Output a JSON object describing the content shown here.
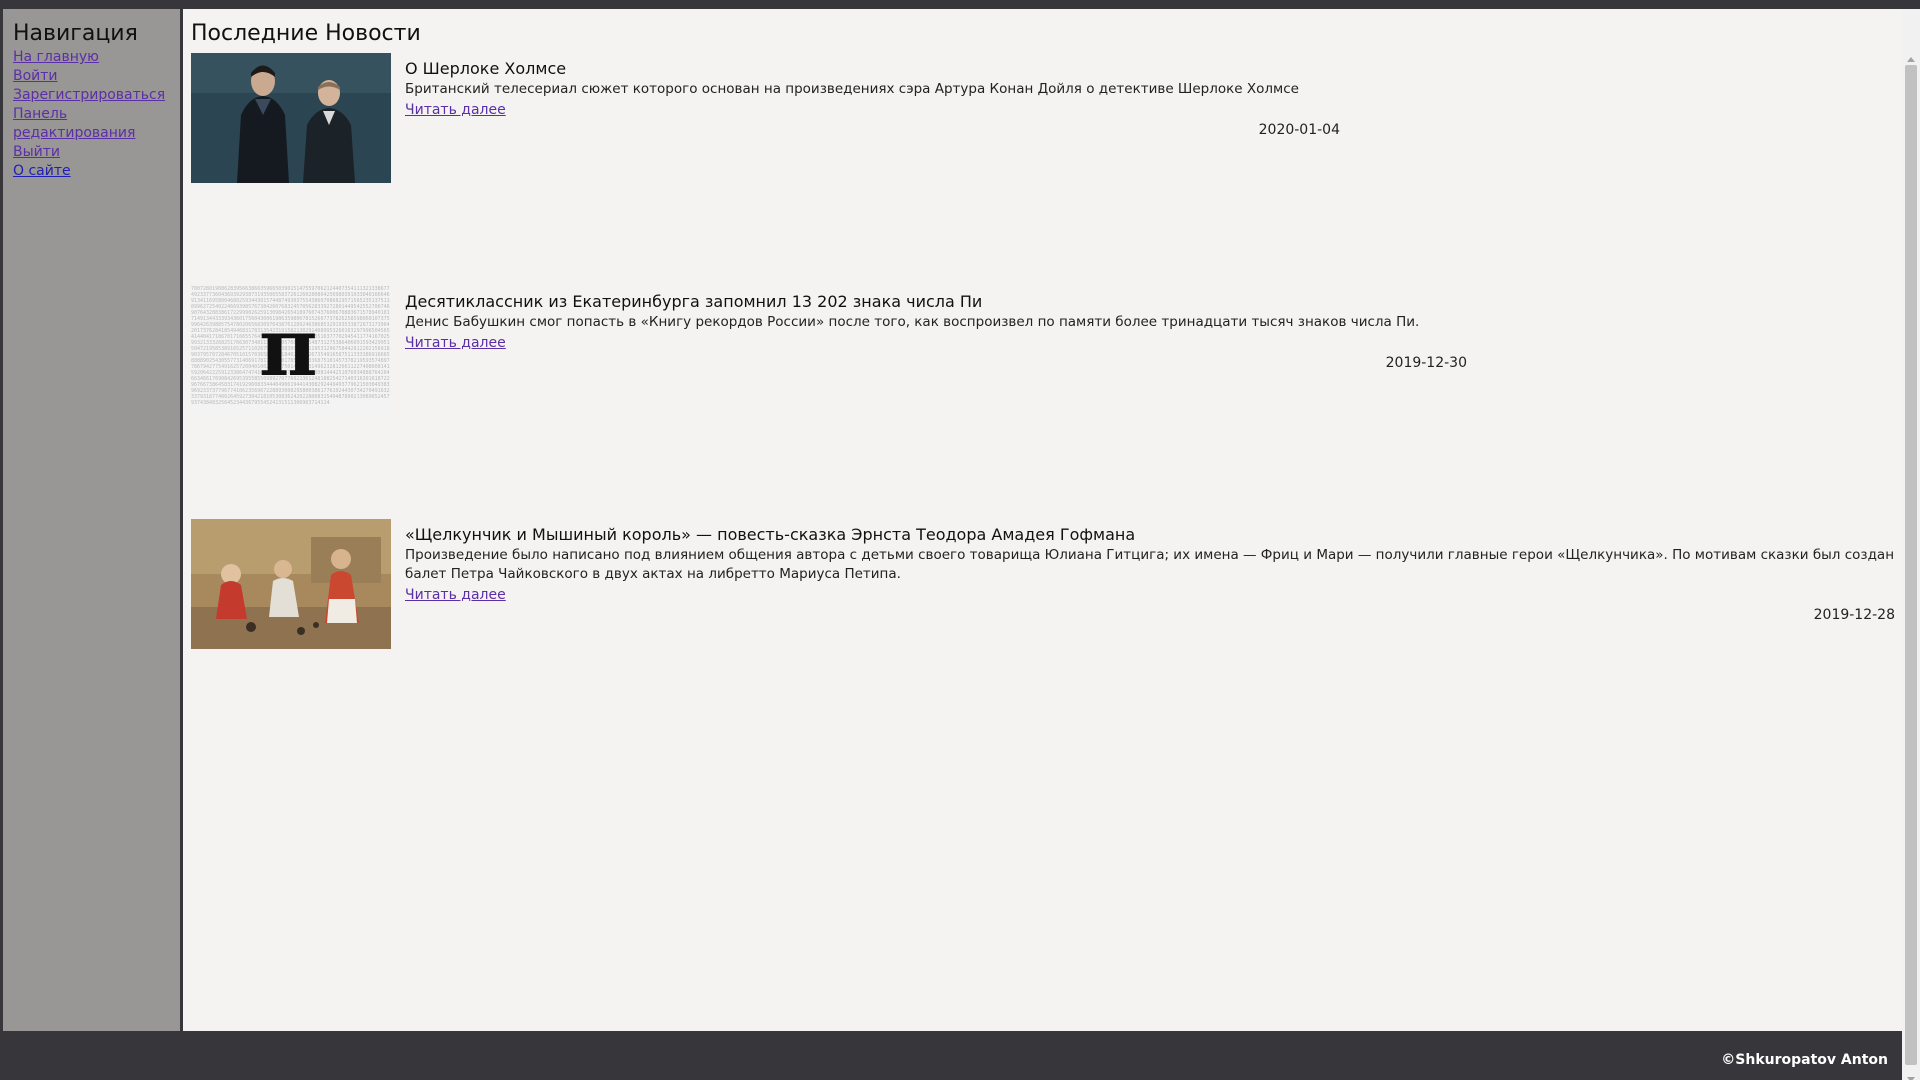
{
  "sidebar": {
    "title": "Навигация",
    "links": [
      {
        "label": "На главную"
      },
      {
        "label": "Войти"
      },
      {
        "label": "Зарегистрироваться"
      },
      {
        "label": "Панель редактирования"
      },
      {
        "label": "Выйти"
      },
      {
        "label": "О сайте"
      }
    ]
  },
  "main": {
    "title": "Последние Новости",
    "read_more_label": "Читать далее",
    "news": [
      {
        "title": "О Шерлоке Холмсе",
        "text": "Британский телесериал сюжет которого основан на произведениях сэра Артура Конан Дойля о детективе Шерлоке Холмсе",
        "date": "2020-01-04",
        "image": "sherlock-image"
      },
      {
        "title": "Десятиклассник из Екатеринбурга запомнил 13 202 знака числа Пи",
        "text": "Денис Бабушкин смог попасть в «Книгу рекордов России» после того, как воспроизвел по памяти более тринадцати тысяч знаков числа Пи.",
        "date": "2019-12-30",
        "image": "pi-image"
      },
      {
        "title": "«Щелкунчик и Мышиный король» — повесть-сказка Эрнста Теодора Амадея Гофмана",
        "text": "Произведение было написано под влиянием общения автора с детьми своего товарища Юлиана Гитцига; их имена — Фриц и Мари — получили главные герои «Щелкунчика». По мотивам сказки был создан балет Петра Чайковского в двух актах на либретто Мариуса Петипа.",
        "date": "2019-12-28",
        "image": "nutcracker-image"
      }
    ]
  },
  "footer": {
    "copyright": "©Shkuropatov Anton"
  }
}
